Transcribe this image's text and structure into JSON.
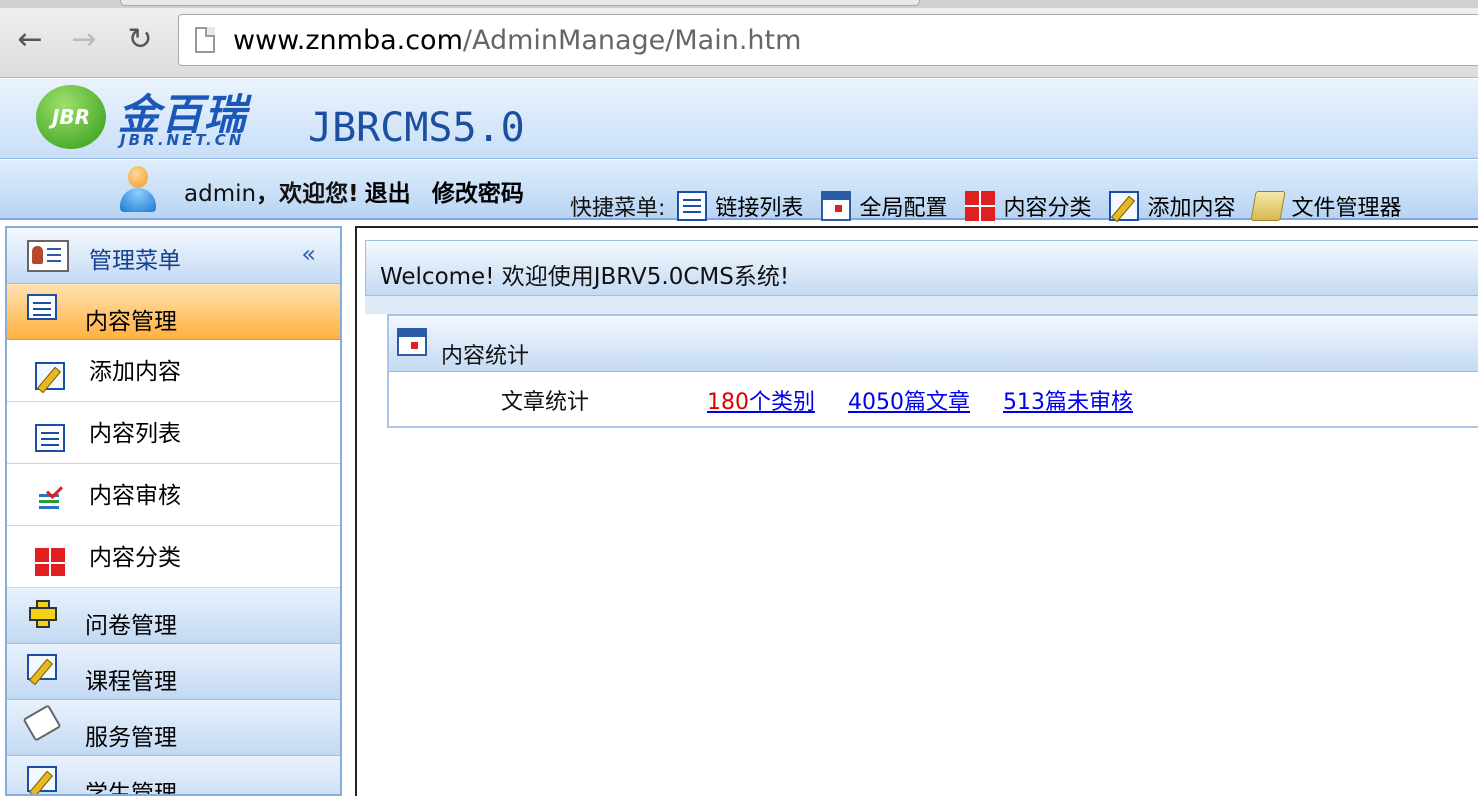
{
  "browser": {
    "url_host": "www.znmba.com",
    "url_path": "/AdminManage/Main.htm",
    "back_icon": "back-arrow-icon",
    "forward_icon": "forward-arrow-icon",
    "reload_icon": "reload-icon"
  },
  "header": {
    "logo_badge": "JBR",
    "logo_cn": "金百瑞",
    "logo_sub": "JBR.NET.CN",
    "brand": "JBRCMS5.0"
  },
  "userbar": {
    "username": "admin",
    "welcome": "，欢迎您!",
    "logout": "退出",
    "change_password": "修改密码",
    "quick_menu_label": "快捷菜单:",
    "quick_items": [
      {
        "label": "链接列表",
        "icon": "list-icon"
      },
      {
        "label": "全局配置",
        "icon": "calendar-icon"
      },
      {
        "label": "内容分类",
        "icon": "grid-icon"
      },
      {
        "label": "添加内容",
        "icon": "edit-icon"
      },
      {
        "label": "文件管理器",
        "icon": "folder-icon"
      }
    ]
  },
  "sidebar": {
    "title": "管理菜单",
    "collapse": "«",
    "groups": [
      {
        "label": "内容管理",
        "icon": "list-icon",
        "active": true
      },
      {
        "label": "问卷管理",
        "icon": "plus-icon"
      },
      {
        "label": "课程管理",
        "icon": "edit-icon"
      },
      {
        "label": "服务管理",
        "icon": "tag-icon"
      },
      {
        "label": "学生管理",
        "icon": "edit-icon"
      }
    ],
    "items": [
      {
        "label": "添加内容",
        "icon": "edit-icon"
      },
      {
        "label": "内容列表",
        "icon": "list-icon"
      },
      {
        "label": "内容审核",
        "icon": "check-icon"
      },
      {
        "label": "内容分类",
        "icon": "grid-icon"
      }
    ]
  },
  "main": {
    "welcome": "Welcome! 欢迎使用JBRV5.0CMS系统!",
    "panel_title": "内容统计",
    "stats_label": "文章统计",
    "stats": {
      "category_count": "180",
      "category_suffix": "个类别",
      "articles": "4050篇文章",
      "pending": "513篇未审核"
    }
  }
}
